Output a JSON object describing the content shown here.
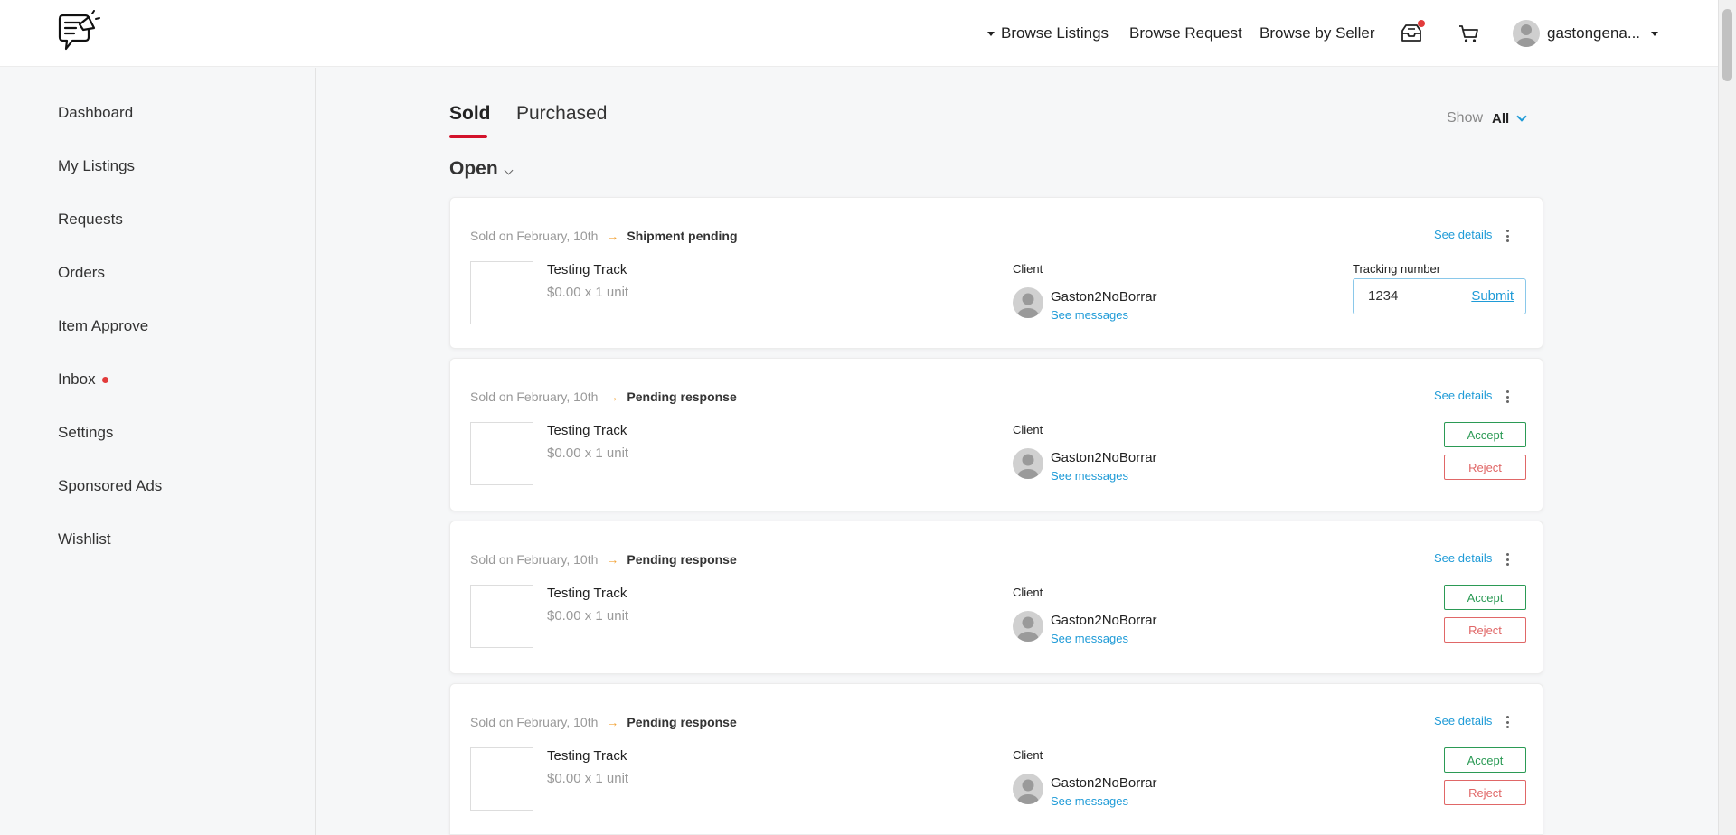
{
  "header": {
    "nav": {
      "browse_listings": "Browse Listings",
      "browse_request": "Browse Request",
      "browse_by_seller": "Browse by Seller"
    },
    "icons": {
      "inbox": "inbox-tray-icon",
      "cart": "cart-icon",
      "logo": "megaphone-chat-logo"
    },
    "user": {
      "name": "gastongena..."
    }
  },
  "sidebar": {
    "items": [
      {
        "label": "Dashboard"
      },
      {
        "label": "My Listings"
      },
      {
        "label": "Requests"
      },
      {
        "label": "Orders"
      },
      {
        "label": "Item Approve"
      },
      {
        "label": "Inbox",
        "has_notification": true
      },
      {
        "label": "Settings"
      },
      {
        "label": "Sponsored Ads"
      },
      {
        "label": "Wishlist"
      }
    ]
  },
  "main": {
    "tabs": [
      {
        "label": "Sold",
        "active": true
      },
      {
        "label": "Purchased",
        "active": false
      }
    ],
    "show_label": "Show",
    "show_value": "All",
    "status_filter": "Open",
    "orders": [
      {
        "sold_on": "Sold on February, 10th",
        "status": "Shipment pending",
        "see_details": "See details",
        "item_title": "Testing Track",
        "item_price": "$0.00 x 1 unit",
        "client_label": "Client",
        "client_name": "Gaston2NoBorrar",
        "see_messages": "See messages",
        "tracking_label": "Tracking number",
        "tracking_value": "1234",
        "submit_label": "Submit"
      },
      {
        "sold_on": "Sold on February, 10th",
        "status": "Pending response",
        "see_details": "See details",
        "item_title": "Testing Track",
        "item_price": "$0.00 x 1 unit",
        "client_label": "Client",
        "client_name": "Gaston2NoBorrar",
        "see_messages": "See messages",
        "accept_label": "Accept",
        "reject_label": "Reject"
      },
      {
        "sold_on": "Sold on February, 10th",
        "status": "Pending response",
        "see_details": "See details",
        "item_title": "Testing Track",
        "item_price": "$0.00 x 1 unit",
        "client_label": "Client",
        "client_name": "Gaston2NoBorrar",
        "see_messages": "See messages",
        "accept_label": "Accept",
        "reject_label": "Reject"
      },
      {
        "sold_on": "Sold on February, 10th",
        "status": "Pending response",
        "see_details": "See details",
        "item_title": "Testing Track",
        "item_price": "$0.00 x 1 unit",
        "client_label": "Client",
        "client_name": "Gaston2NoBorrar",
        "see_messages": "See messages",
        "accept_label": "Accept",
        "reject_label": "Reject"
      }
    ]
  },
  "colors": {
    "brand_red": "#d3132b",
    "link_blue": "#1f9bd7",
    "accept_green": "#2b9a55",
    "reject_red": "#e06767",
    "arrow_orange": "#f2a43a",
    "notification_red": "#e23b3b"
  }
}
